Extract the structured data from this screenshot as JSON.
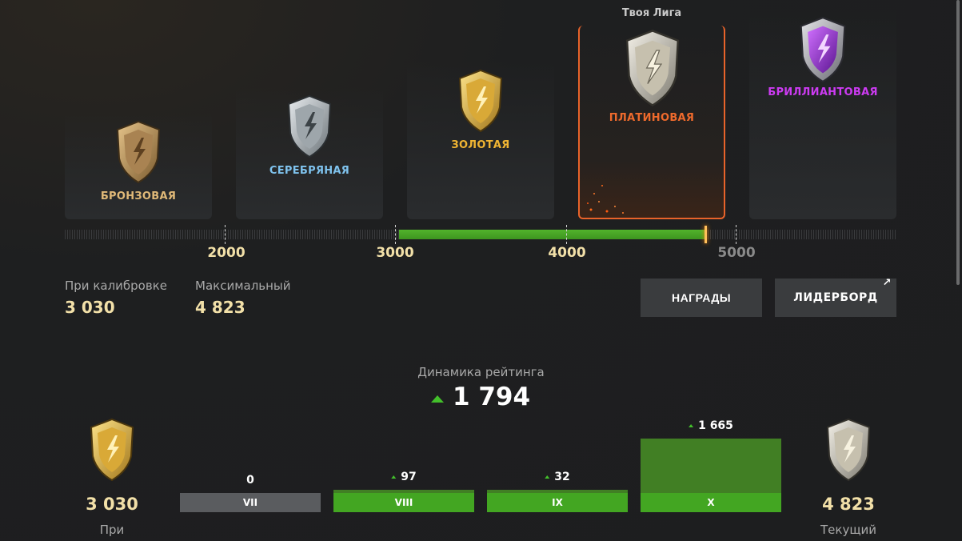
{
  "your_league_label": "Твоя Лига",
  "leagues": [
    {
      "name": "БРОНЗОВАЯ",
      "color": "#e0b978",
      "icon": "bronze-shield-icon"
    },
    {
      "name": "СЕРЕБРЯНАЯ",
      "color": "#7fc3ee",
      "icon": "silver-shield-icon"
    },
    {
      "name": "ЗОЛОТАЯ",
      "color": "#f0b533",
      "icon": "gold-shield-icon"
    },
    {
      "name": "ПЛАТИНОВАЯ",
      "color": "#ee6a2c",
      "icon": "platinum-shield-icon",
      "current": true
    },
    {
      "name": "БРИЛЛИАНТОВАЯ",
      "color": "#cc3bf2",
      "icon": "diamond-shield-icon"
    }
  ],
  "rating_track": {
    "ticks": [
      "2000",
      "3000",
      "4000",
      "5000"
    ],
    "fill_start": 3030,
    "fill_end": 4823
  },
  "stats": {
    "calibration_label": "При калибровке",
    "calibration_value": "3 030",
    "max_label": "Максимальный",
    "max_value": "4 823"
  },
  "buttons": {
    "rewards": "НАГРАДЫ",
    "leaderboard": "ЛИДЕРБОРД"
  },
  "dynamics": {
    "title": "Динамика рейтинга",
    "value": "1 794"
  },
  "start": {
    "value": "3 030",
    "label": "При",
    "icon": "gold-shield-icon"
  },
  "end": {
    "value": "4 823",
    "label": "Текущий",
    "icon": "platinum-shield-icon"
  },
  "chart_data": {
    "type": "bar",
    "title": "Динамика рейтинга",
    "categories": [
      "VII",
      "VIII",
      "IX",
      "X"
    ],
    "values": [
      0,
      97,
      32,
      1665
    ],
    "value_labels": [
      "0",
      "97",
      "32",
      "1 665"
    ],
    "colors": {
      "positive": "#43a622",
      "zero": "#5a5c5f"
    }
  }
}
